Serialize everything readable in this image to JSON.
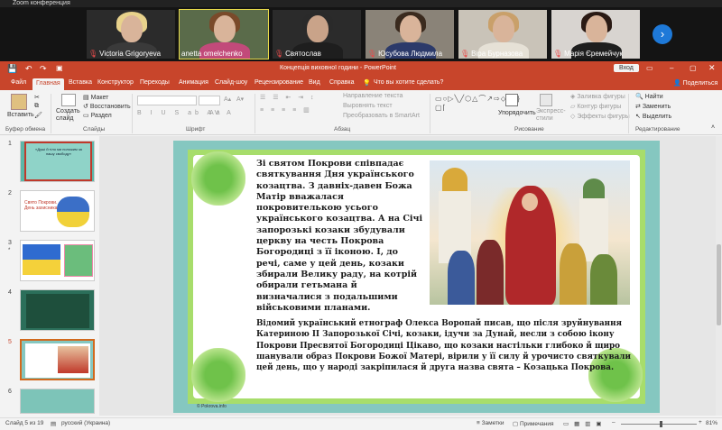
{
  "zoom": {
    "title": "Zoom конференция",
    "participants": [
      {
        "name": "Victoria Grigoryeva",
        "muted": true
      },
      {
        "name": "anetta omelchenko",
        "muted": false
      },
      {
        "name": "Святослав",
        "muted": true
      },
      {
        "name": "Юсубова Людмила",
        "muted": true
      },
      {
        "name": "Віра Бурназова",
        "muted": true
      },
      {
        "name": "Марія Єремейчук",
        "muted": true
      }
    ],
    "next_icon": "chevron-right-icon"
  },
  "ppt": {
    "window_title": "Концепція виховної години  -  PowerPoint",
    "login": "Вход",
    "tabs": [
      "Файл",
      "Главная",
      "Вставка",
      "Конструктор",
      "Переходы",
      "Анимация",
      "Слайд-шоу",
      "Рецензирование",
      "Вид",
      "Справка"
    ],
    "tell_me": "Что вы хотите сделать?",
    "share": "Поделиться",
    "ribbon": {
      "paste": "Вставить",
      "clipboard": "Буфер обмена",
      "new_slide": "Создать слайд",
      "layout": "Макет",
      "reset": "Восстановить",
      "section": "Раздел",
      "slides": "Слайды",
      "font": "Шрифт",
      "text_direction": "Направление текста",
      "align_text": "Выровнять текст",
      "smartart": "Преобразовать в SmartArt",
      "paragraph": "Абзац",
      "arrange": "Упорядочить",
      "quick_styles": "Экспресс-стили",
      "shape_fill": "Заливка фигуры",
      "shape_outline": "Контур фигуры",
      "shape_effects": "Эффекты фигуры",
      "drawing": "Рисование",
      "find": "Найти",
      "replace": "Заменить",
      "select": "Выделить",
      "editing": "Редактирование"
    },
    "slide_numbers": [
      "1",
      "2",
      "3",
      "4",
      "5",
      "6"
    ],
    "thumb1_text": "«Душі й тіло ми положим за нашу свободу»",
    "thumb2_text": "Свято Покрови. День захисника",
    "slide": {
      "para1": "Зі святом Покрови співпадає святкування Дня українського козацтва. З давніх-давен Божа Матір вважалася покровителькою усього українського козацтва. А на Січі запорозькі козаки збудували церкву на честь Покрова Богородиці з її іконою. І, до речі, саме у цей день, козаки збирали Велику раду, на котрій обирали гетьмана й визначалися з подальшими військовими планами.",
      "para2": "Відомий український етнограф Олекса Воропай писав, що після зруйнування Катериною II Запорозької Січі, козаки, ідучи за Дунай, несли з собою ікону Покрови Пресвятої Богородиці Цікаво, що козаки настільки глибоко й щиро шанували образ Покрови Божої Матері, вірили у її силу й урочисто святкували цей день, що у народі закріпилася й друга назва свята – Козацька Покрова.",
      "watermark": "© Pokrova.info"
    },
    "status": {
      "slide_of": "Слайд 5 из 19",
      "language": "русский (Украина)",
      "notes": "Заметки",
      "comments": "Примечания",
      "zoom": "81%"
    },
    "colors": {
      "accent": "#c8452b",
      "slide_bg": "#85c7c0",
      "title_text": "#1a1a1a"
    }
  }
}
